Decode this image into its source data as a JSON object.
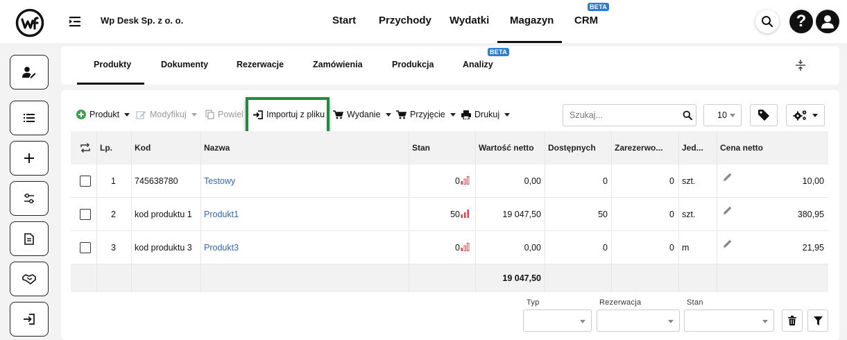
{
  "company": "Wp Desk Sp. z o. o.",
  "nav": {
    "start": "Start",
    "przychody": "Przychody",
    "wydatki": "Wydatki",
    "magazyn": "Magazyn",
    "crm": "CRM",
    "crm_badge": "BETA",
    "active": "Magazyn"
  },
  "subtabs": {
    "produkty": "Produkty",
    "dokumenty": "Dokumenty",
    "rezerwacje": "Rezerwacje",
    "zamowienia": "Zamówienia",
    "produkcja": "Produkcja",
    "analizy": "Analizy",
    "analizy_badge": "BETA",
    "active": "Produkty"
  },
  "toolbar": {
    "produkt": "Produkt",
    "modyfikuj": "Modyfikuj",
    "powiel": "Powiel",
    "importuj": "Importuj z pliku",
    "wydanie": "Wydanie",
    "przyjecie": "Przyjęcie",
    "drukuj": "Drukuj",
    "search_placeholder": "Szukaj...",
    "page_size": "10"
  },
  "table": {
    "headers": {
      "lp": "Lp.",
      "kod": "Kod",
      "nazwa": "Nazwa",
      "stan": "Stan",
      "wartosc": "Wartość netto",
      "dostepnych": "Dostępnych",
      "zarezerwowane": "Zarezerwo...",
      "jednostka": "Jed...",
      "cena": "Cena netto"
    },
    "rows": [
      {
        "lp": "1",
        "kod": "745638780",
        "nazwa": "Testowy",
        "stan": "0",
        "stan_level": 0,
        "wartosc": "0,00",
        "dostepnych": "0",
        "zarezerwowane": "0",
        "jednostka": "szt.",
        "cena": "10,00"
      },
      {
        "lp": "2",
        "kod": "kod produktu 1",
        "nazwa": "Produkt1",
        "stan": "50",
        "stan_level": 3,
        "wartosc": "19 047,50",
        "dostepnych": "50",
        "zarezerwowane": "0",
        "jednostka": "szt.",
        "cena": "380,95"
      },
      {
        "lp": "3",
        "kod": "kod produktu 3",
        "nazwa": "Produkt3",
        "stan": "0",
        "stan_level": 0,
        "wartosc": "0,00",
        "dostepnych": "0",
        "zarezerwowane": "0",
        "jednostka": "m",
        "cena": "21,95"
      }
    ],
    "sum_wartosc": "19 047,50"
  },
  "filters": {
    "typ": "Typ",
    "rezerwacja": "Rezerwacja",
    "stan": "Stan"
  },
  "colors": {
    "accent_green": "#1e8c3a",
    "link_blue": "#3567b0",
    "beta_blue": "#2c7ed0",
    "stock_red": "#e0404a"
  },
  "icons": {
    "sidebar": [
      "user-edit-icon",
      "list-icon",
      "plus-icon",
      "sliders-icon",
      "document-icon",
      "handshake-icon",
      "sign-in-icon"
    ]
  }
}
